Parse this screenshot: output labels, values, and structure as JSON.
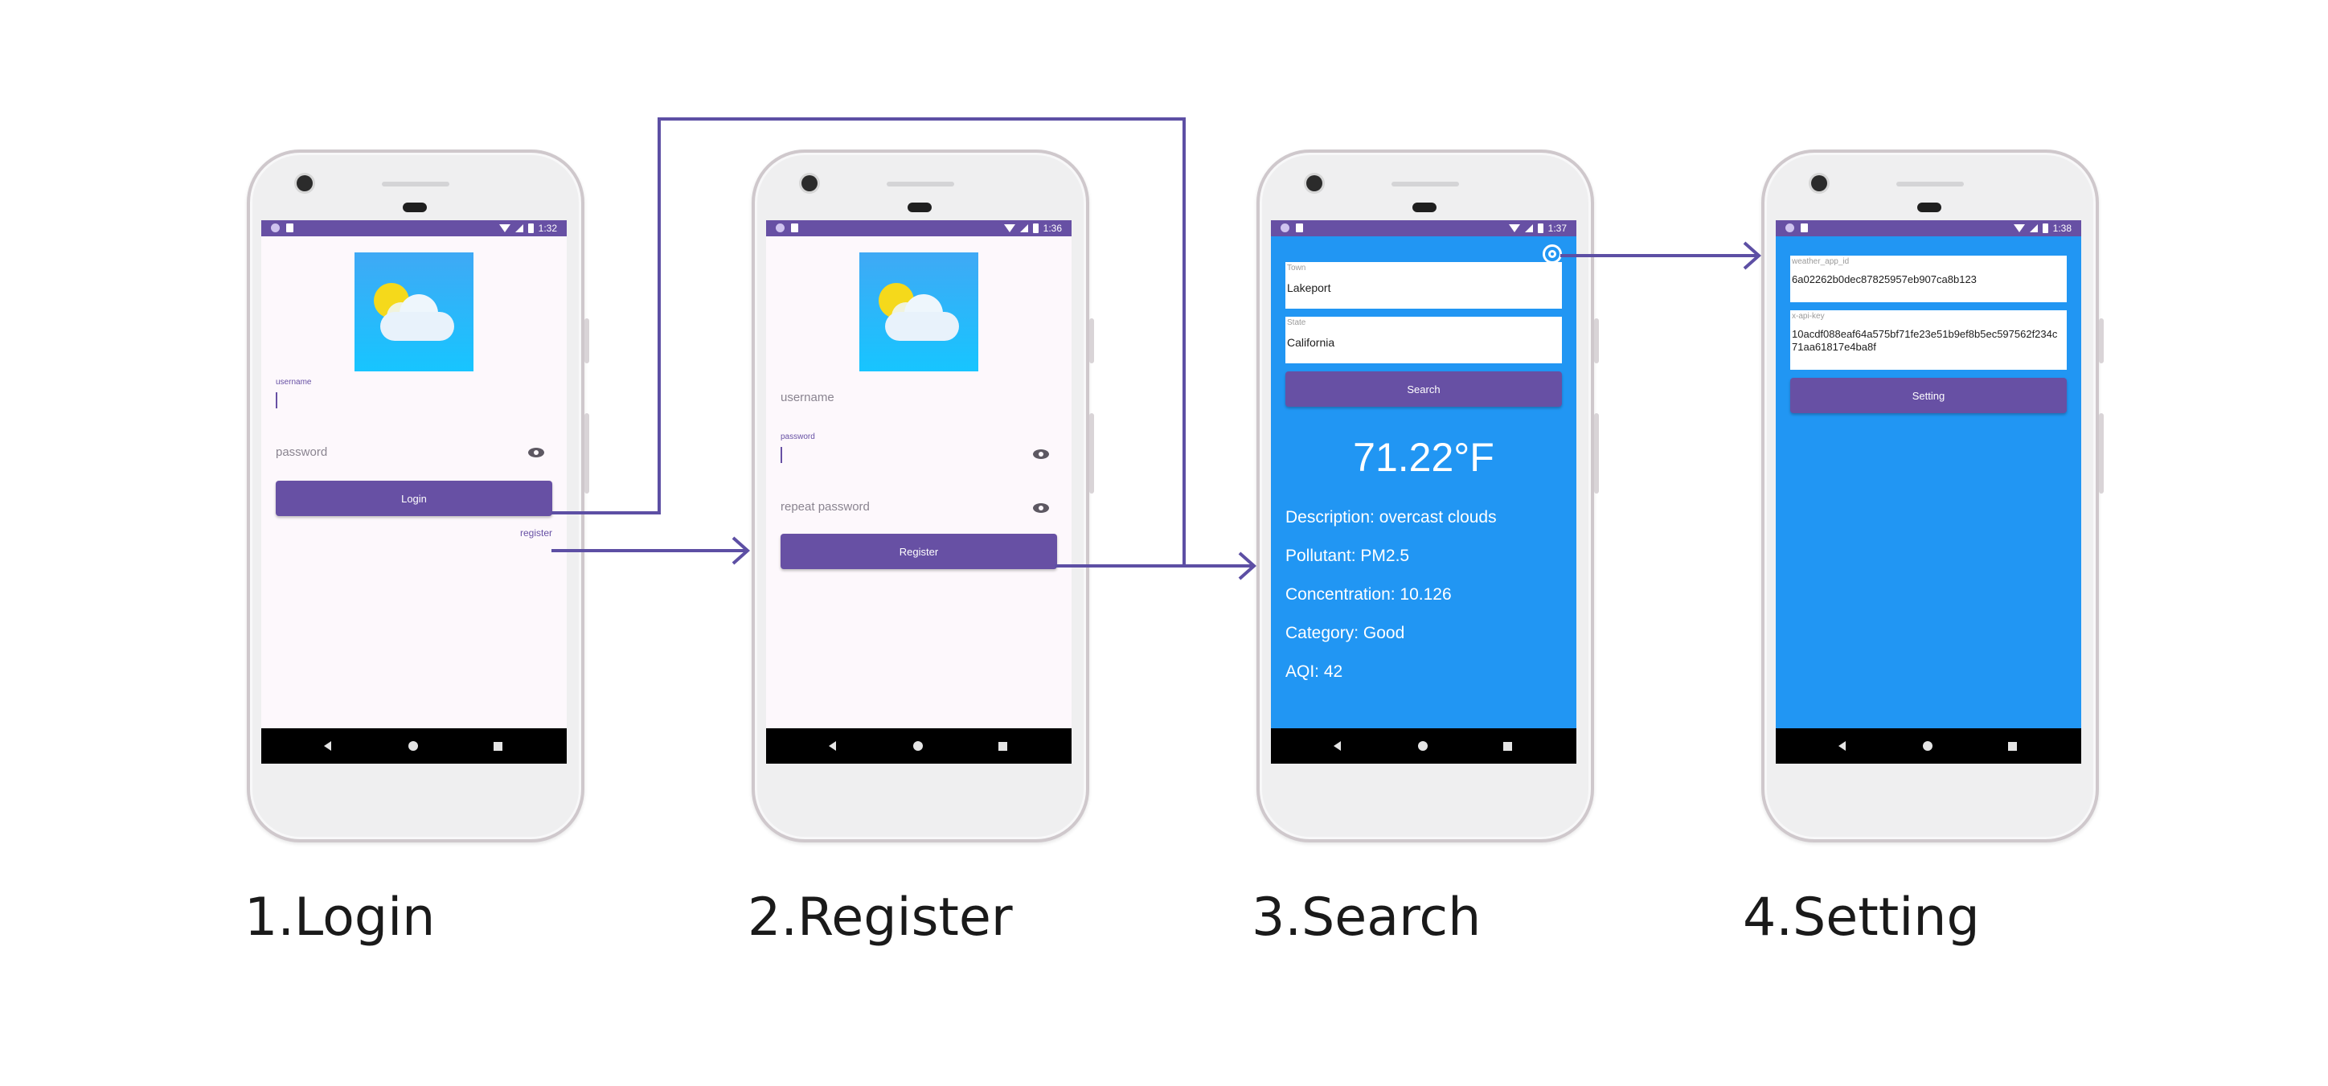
{
  "colors": {
    "primary": "#6750a4",
    "weather_blue": "#2196f3",
    "arrow": "#5d4fa4"
  },
  "steps": [
    {
      "label": "1.Login",
      "time": "1:32",
      "username_label": "username",
      "password_placeholder": "password",
      "login_button": "Login",
      "register_link": "register"
    },
    {
      "label": "2.Register",
      "time": "1:36",
      "username_placeholder": "username",
      "password_label": "password",
      "repeat_password_placeholder": "repeat password",
      "register_button": "Register"
    },
    {
      "label": "3.Search",
      "time": "1:37",
      "town_label": "Town",
      "town_value": "Lakeport",
      "state_label": "State",
      "state_value": "California",
      "search_button": "Search",
      "temperature": "71.22°F",
      "description": "Description: overcast clouds",
      "pollutant": "Pollutant: PM2.5",
      "concentration": "Concentration: 10.126",
      "category": "Category: Good",
      "aqi": "AQI: 42"
    },
    {
      "label": "4.Setting",
      "time": "1:38",
      "app_id_label": "weather_app_id",
      "app_id_value": "6a02262b0dec87825957eb907ca8b123",
      "api_key_label": "x-api-key",
      "api_key_value": "10acdf088eaf64a575bf71fe23e51b9ef8b5ec597562f234c71aa61817e4ba8f",
      "setting_button": "Setting"
    }
  ],
  "icons": {
    "status_left": [
      "circle-icon",
      "sd-card-icon"
    ],
    "status_right": [
      "wifi-icon",
      "signal-icon",
      "battery-icon"
    ],
    "nav": [
      "back-icon",
      "home-icon",
      "recents-icon"
    ],
    "settings": "gear-icon",
    "visibility": "eye-icon",
    "logo": "weather-logo"
  }
}
